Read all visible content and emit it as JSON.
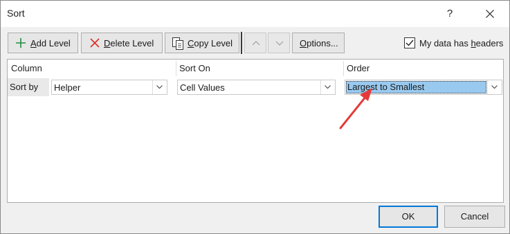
{
  "window": {
    "title": "Sort",
    "help_label": "?"
  },
  "toolbar": {
    "add_level": {
      "accel": "A",
      "rest": "dd Level"
    },
    "delete_level": {
      "accel": "D",
      "rest": "elete Level"
    },
    "copy_level": {
      "accel": "C",
      "rest": "opy Level"
    },
    "options": {
      "accel": "O",
      "rest": "ptions..."
    },
    "headers_checkbox": {
      "label_pre": "My data has ",
      "label_accel": "h",
      "label_post": "eaders",
      "checked": true
    }
  },
  "grid": {
    "columns": [
      "Column",
      "Sort On",
      "Order"
    ],
    "rows": [
      {
        "label": "Sort by",
        "column": "Helper",
        "sort_on": "Cell Values",
        "order": "Largest to Smallest"
      }
    ]
  },
  "footer": {
    "ok_label": "OK",
    "cancel_label": "Cancel"
  },
  "colors": {
    "selection": "#99c9ef",
    "annotation_arrow": "#e63a3a",
    "focus_border": "#0078d7"
  }
}
